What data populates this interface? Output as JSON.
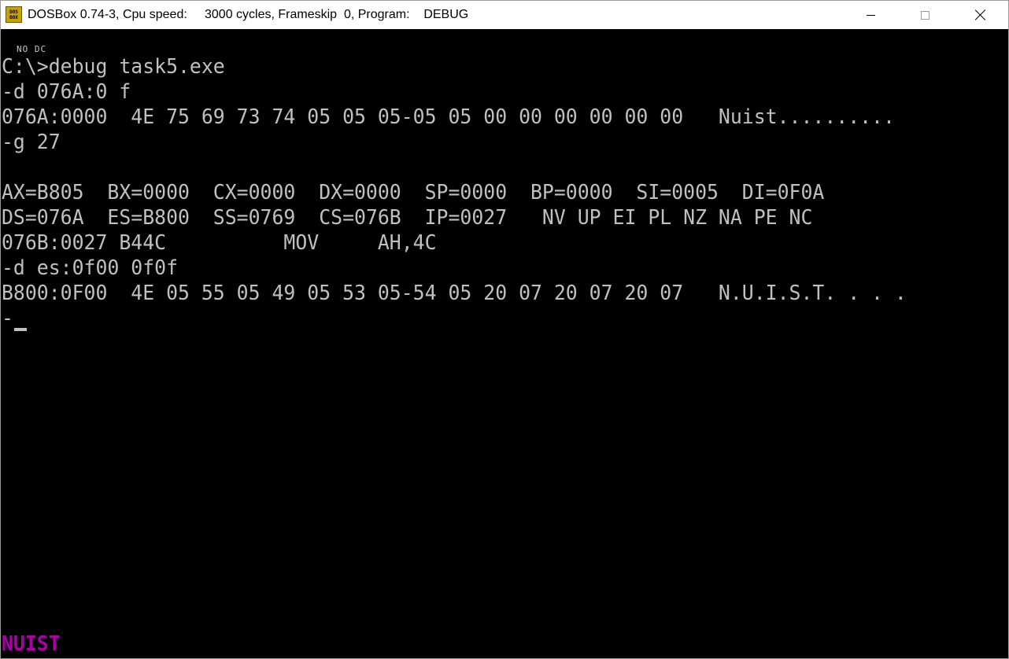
{
  "window": {
    "title": "DOSBox 0.74-3, Cpu speed:     3000 cycles, Frameskip  0, Program:    DEBUG",
    "icon_line1": "DOS",
    "icon_line2": "BOX",
    "icon": "dosbox-app-icon"
  },
  "controls": {
    "minimize_icon": "minimize-icon",
    "maximize_icon": "maximize-icon",
    "close_icon": "close-icon"
  },
  "terminal": {
    "indicator": "NO DC",
    "lines": [
      "C:\\>debug task5.exe",
      "-d 076A:0 f",
      "076A:0000  4E 75 69 73 74 05 05 05-05 05 00 00 00 00 00 00   Nuist..........",
      "-g 27",
      "",
      "AX=B805  BX=0000  CX=0000  DX=0000  SP=0000  BP=0000  SI=0005  DI=0F0A",
      "DS=076A  ES=B800  SS=0769  CS=076B  IP=0027   NV UP EI PL NZ NA PE NC",
      "076B:0027 B44C          MOV     AH,4C",
      "-d es:0f00 0f0f",
      "B800:0F00  4E 05 55 05 49 05 53 05-54 05 20 07 20 07 20 07   N.U.I.S.T. . . .",
      "-"
    ],
    "screen_output": "NUIST",
    "colors": {
      "background": "#000000",
      "text": "#c0c0c0",
      "output_magenta": "#aa00aa"
    }
  }
}
